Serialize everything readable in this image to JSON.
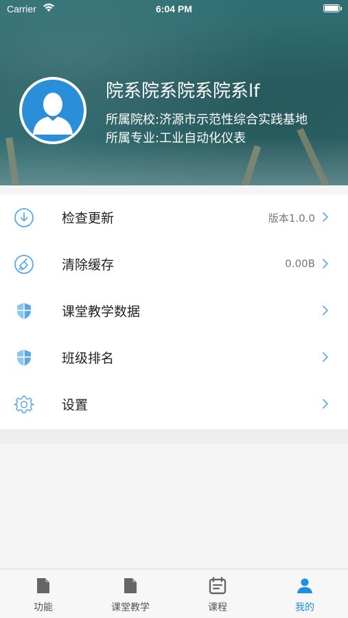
{
  "status_bar": {
    "carrier": "Carrier",
    "time": "6:04 PM"
  },
  "profile": {
    "name": "院系院系院系院系lf",
    "school": "所属院校:济源市示范性综合实践基地",
    "major": "所属专业:工业自动化仪表"
  },
  "menu": {
    "items": [
      {
        "label": "检查更新",
        "value": "版本1.0.0",
        "icon": "download-icon"
      },
      {
        "label": "清除缓存",
        "value": "0.00B",
        "icon": "broom-icon"
      },
      {
        "label": "课堂教学数据",
        "value": "",
        "icon": "shield-icon"
      },
      {
        "label": "班级排名",
        "value": "",
        "icon": "shield-icon"
      },
      {
        "label": "设置",
        "value": "",
        "icon": "gear-icon"
      }
    ]
  },
  "tabbar": {
    "tabs": [
      {
        "label": "功能",
        "icon": "document-icon",
        "active": false
      },
      {
        "label": "课堂教学",
        "icon": "document-icon",
        "active": false
      },
      {
        "label": "课程",
        "icon": "calendar-icon",
        "active": false
      },
      {
        "label": "我的",
        "icon": "person-icon",
        "active": true
      }
    ]
  },
  "colors": {
    "accent": "#1f8fe0",
    "icon_blue": "#5aa9e6",
    "header_bg": "#2c676b"
  }
}
